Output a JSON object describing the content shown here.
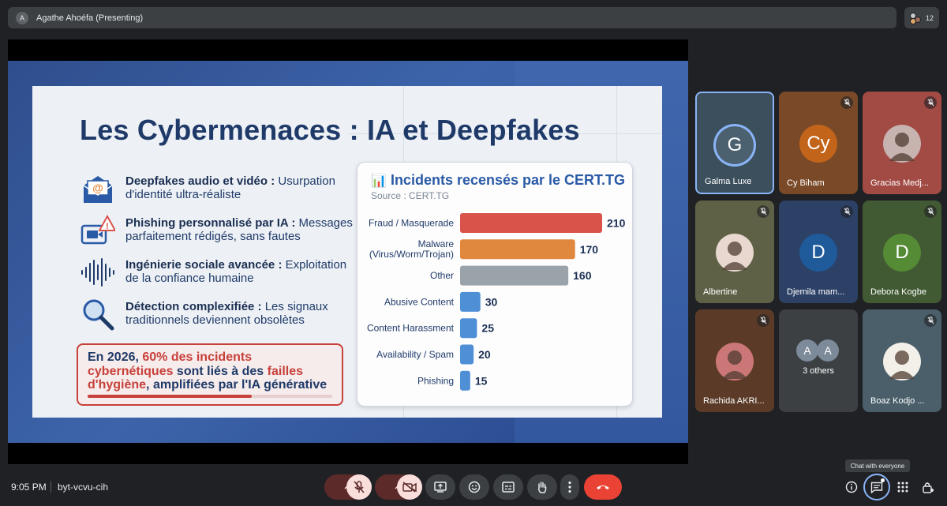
{
  "header": {
    "presenter_initial": "A",
    "presenter_label": "Agathe Ahoéfa (Presenting)",
    "participant_count": "12"
  },
  "slide": {
    "title": "Les Cybermenaces : IA et Deepfakes",
    "bullets": [
      {
        "bold": "Deepfakes audio et vidéo :",
        "text": " Usurpation d'identité ultra-réaliste",
        "icon": "email-icon"
      },
      {
        "bold": "Phishing personnalisé par IA :",
        "text": " Messages parfaitement rédigés, sans fautes",
        "icon": "video-warning-icon"
      },
      {
        "bold": "Ingénierie sociale avancée :",
        "text": " Exploitation de la confiance humaine",
        "icon": "soundwave-icon"
      },
      {
        "bold": "Détection complexifiée :",
        "text": " Les signaux traditionnels deviennent obsolètes",
        "icon": "magnifier-icon"
      }
    ],
    "callout": {
      "p1": "En 2026, ",
      "r1": "60% des incidents cybernétiques",
      "p2": " sont liés à des ",
      "r2": "failles d'hygiène",
      "p3": ", amplifiées par l'IA générative",
      "progress": 0.67
    },
    "chart_card": {
      "icon": "📊",
      "title": "Incidents recensés par le CERT.TG",
      "source": "Source : CERT.TG"
    }
  },
  "chart_data": {
    "type": "bar",
    "orientation": "horizontal",
    "title": "Incidents recensés par le CERT.TG",
    "categories": [
      "Fraud / Masquerade",
      "Malware (Virus/Worm/Trojan)",
      "Other",
      "Abusive Content",
      "Content Harassment",
      "Availability / Spam",
      "Phishing"
    ],
    "category_lines": [
      [
        "Fraud / Masquerade"
      ],
      [
        "Malware",
        "(Virus/Worm/Trojan)"
      ],
      [
        "Other"
      ],
      [
        "Abusive Content"
      ],
      [
        "Content Harassment"
      ],
      [
        "Availability / Spam"
      ],
      [
        "Phishing"
      ]
    ],
    "values": [
      210,
      170,
      160,
      30,
      25,
      20,
      15
    ],
    "bar_colors": [
      "#d9534a",
      "#e0883e",
      "#9aa3aa",
      "#4f8fd6",
      "#4f8fd6",
      "#4f8fd6",
      "#4f8fd6"
    ],
    "xlim": [
      0,
      210
    ],
    "grid": false,
    "data_labels": true
  },
  "participants": [
    {
      "name": "Galma Luxe",
      "initial": "G",
      "color": "#4c6170",
      "bg": "#3c4f5c",
      "active": true,
      "muted": false,
      "photo": false
    },
    {
      "name": "Cy Biham",
      "initial": "Cy",
      "color": "#c2641a",
      "bg": "#7a4a28",
      "active": false,
      "muted": true,
      "photo": false
    },
    {
      "name": "Gracias Medj...",
      "initial": "",
      "color": "#c7b3b0",
      "bg": "#a24a44",
      "active": false,
      "muted": true,
      "photo": true
    },
    {
      "name": "Albertine",
      "initial": "",
      "color": "#e8d8cf",
      "bg": "#5f6147",
      "active": false,
      "muted": true,
      "photo": true
    },
    {
      "name": "Djemila mam...",
      "initial": "D",
      "color": "#1f5a9a",
      "bg": "#2d4166",
      "active": false,
      "muted": true,
      "photo": false
    },
    {
      "name": "Debora Kogbe",
      "initial": "D",
      "color": "#558b35",
      "bg": "#415a33",
      "active": false,
      "muted": true,
      "photo": false
    },
    {
      "name": "Rachida AKRI...",
      "initial": "",
      "color": "#c77",
      "bg": "#5b3b28",
      "active": false,
      "muted": true,
      "photo": true
    },
    {
      "name": "3 others",
      "initial": "A",
      "color": "#7d8a9a",
      "bg": "#3c4043",
      "active": false,
      "muted": false,
      "photo": false,
      "group": true
    },
    {
      "name": "Boaz Kodjo ...",
      "initial": "",
      "color": "#f2f0e8",
      "bg": "#4a5f6a",
      "active": false,
      "muted": true,
      "photo": true
    }
  ],
  "footer": {
    "time": "9:05 PM",
    "meeting_code": "byt-vcvu-cih",
    "tooltip": "Chat with everyone"
  },
  "colors": {
    "accent": "#8ab4f8",
    "hangup": "#ea4335",
    "muted_bg": "#f9dedc"
  }
}
